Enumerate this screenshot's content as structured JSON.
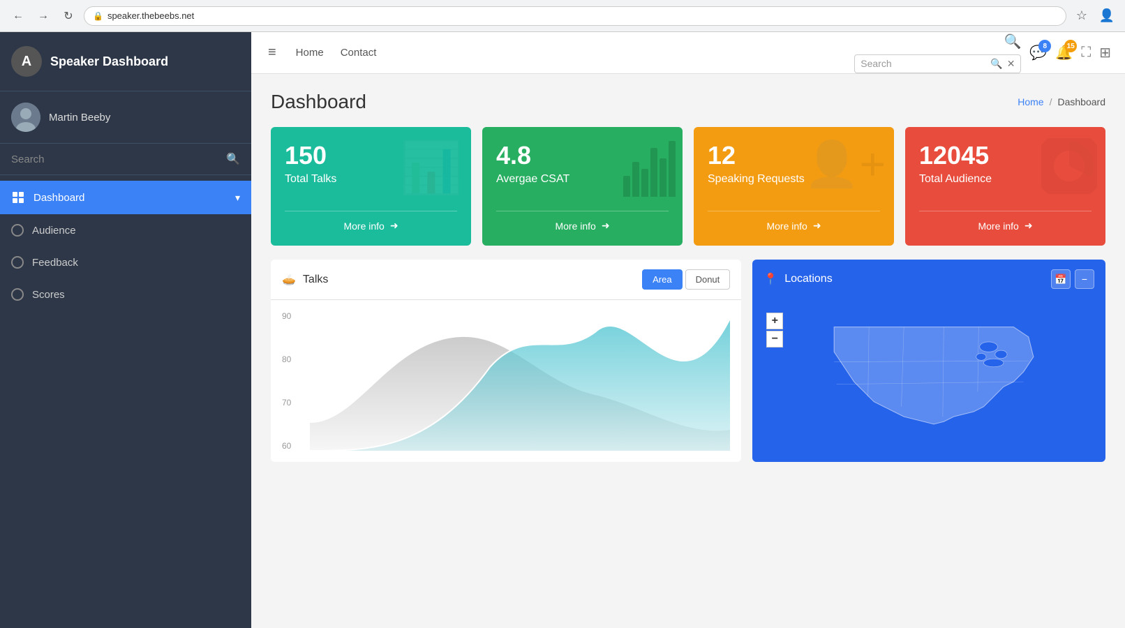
{
  "browser": {
    "url": "speaker.thebeebs.net",
    "back_label": "←",
    "forward_label": "→",
    "refresh_label": "↻",
    "star_label": "☆",
    "profile_label": "👤"
  },
  "sidebar": {
    "logo_letter": "A",
    "title": "Speaker Dashboard",
    "user_name": "Martin Beeby",
    "search_placeholder": "Search",
    "nav_items": [
      {
        "id": "dashboard",
        "label": "Dashboard",
        "icon": "📊",
        "active": true
      },
      {
        "id": "audience",
        "label": "Audience",
        "icon": "radio",
        "active": false
      },
      {
        "id": "feedback",
        "label": "Feedback",
        "icon": "radio",
        "active": false
      },
      {
        "id": "scores",
        "label": "Scores",
        "icon": "radio",
        "active": false
      }
    ]
  },
  "topbar": {
    "menu_icon": "≡",
    "nav_items": [
      "Home",
      "Contact"
    ],
    "search_placeholder": "Search",
    "chat_badge": "8",
    "bell_badge": "15"
  },
  "page": {
    "title": "Dashboard",
    "breadcrumb_home": "Home",
    "breadcrumb_separator": "/",
    "breadcrumb_current": "Dashboard"
  },
  "stat_cards": [
    {
      "number": "150",
      "label": "Total Talks",
      "more_info": "More info",
      "color": "teal",
      "bg_icon": "📊"
    },
    {
      "number": "4.8",
      "label": "Avergae CSAT",
      "more_info": "More info",
      "color": "green",
      "bg_icon": "📈"
    },
    {
      "number": "12",
      "label": "Speaking Requests",
      "more_info": "More info",
      "color": "yellow",
      "bg_icon": "👤"
    },
    {
      "number": "12045",
      "label": "Total Audience",
      "more_info": "More info",
      "color": "red",
      "bg_icon": "🍩"
    }
  ],
  "talks_panel": {
    "title": "Talks",
    "btn_area": "Area",
    "btn_donut": "Donut",
    "y_labels": [
      "90",
      "80",
      "70",
      "60"
    ]
  },
  "locations_panel": {
    "title": "Locations",
    "zoom_in": "+",
    "zoom_out": "−",
    "calendar_icon": "📅",
    "minimize_icon": "−"
  },
  "colors": {
    "accent_blue": "#3b82f6",
    "teal": "#1abc9c",
    "green": "#27ae60",
    "yellow": "#f39c12",
    "red": "#e74c3c",
    "sidebar_bg": "#2d3748",
    "map_bg": "#2563eb"
  }
}
